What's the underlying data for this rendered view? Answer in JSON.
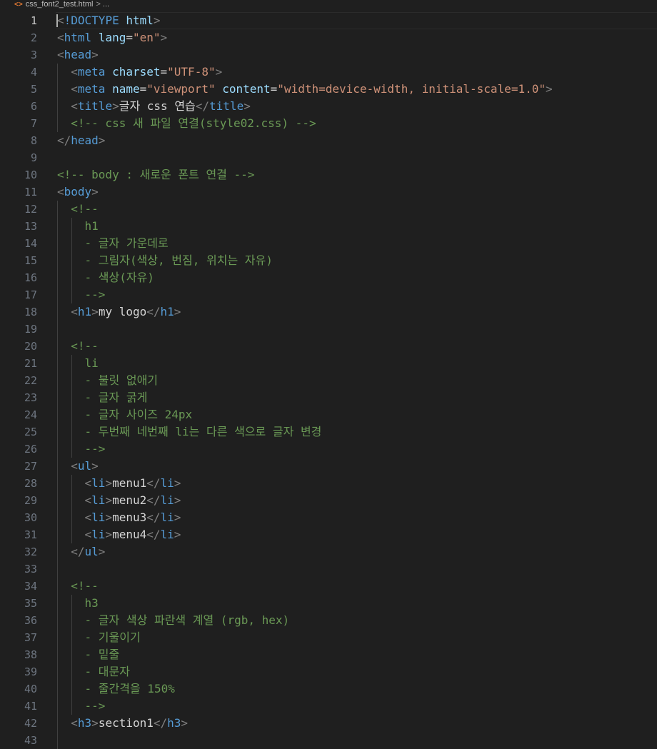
{
  "breadcrumb": {
    "icon": "html-file-icon",
    "icon_glyph": "<>",
    "file_name": "css_font2_test.html",
    "separator": ">",
    "rest": "..."
  },
  "editor": {
    "current_line": 1,
    "lines": [
      {
        "n": "1",
        "indent": 0,
        "tokens": [
          [
            "br",
            "<"
          ],
          [
            "doc",
            "!DOCTYPE "
          ],
          [
            "doctype-name",
            "html"
          ],
          [
            "br",
            ">"
          ]
        ]
      },
      {
        "n": "2",
        "indent": 0,
        "tokens": [
          [
            "br",
            "<"
          ],
          [
            "tag",
            "html "
          ],
          [
            "attr",
            "lang"
          ],
          [
            "text",
            "="
          ],
          [
            "str",
            "\"en\""
          ],
          [
            "br",
            ">"
          ]
        ]
      },
      {
        "n": "3",
        "indent": 0,
        "tokens": [
          [
            "br",
            "<"
          ],
          [
            "tag",
            "head"
          ],
          [
            "br",
            ">"
          ]
        ]
      },
      {
        "n": "4",
        "indent": 1,
        "tokens": [
          [
            "text",
            "  "
          ],
          [
            "br",
            "<"
          ],
          [
            "tag",
            "meta "
          ],
          [
            "attr",
            "charset"
          ],
          [
            "text",
            "="
          ],
          [
            "str",
            "\"UTF-8\""
          ],
          [
            "br",
            ">"
          ]
        ]
      },
      {
        "n": "5",
        "indent": 1,
        "tokens": [
          [
            "text",
            "  "
          ],
          [
            "br",
            "<"
          ],
          [
            "tag",
            "meta "
          ],
          [
            "attr",
            "name"
          ],
          [
            "text",
            "="
          ],
          [
            "str",
            "\"viewport\""
          ],
          [
            "text",
            " "
          ],
          [
            "attr",
            "content"
          ],
          [
            "text",
            "="
          ],
          [
            "str",
            "\"width=device-width, initial-scale=1.0\""
          ],
          [
            "br",
            ">"
          ]
        ]
      },
      {
        "n": "6",
        "indent": 1,
        "tokens": [
          [
            "text",
            "  "
          ],
          [
            "br",
            "<"
          ],
          [
            "tag",
            "title"
          ],
          [
            "br",
            ">"
          ],
          [
            "text",
            "글자 css 연습"
          ],
          [
            "br",
            "</"
          ],
          [
            "tag",
            "title"
          ],
          [
            "br",
            ">"
          ]
        ]
      },
      {
        "n": "7",
        "indent": 1,
        "tokens": [
          [
            "text",
            "  "
          ],
          [
            "com",
            "<!-- css 새 파일 연결(style02.css) -->"
          ]
        ]
      },
      {
        "n": "8",
        "indent": 0,
        "tokens": [
          [
            "br",
            "</"
          ],
          [
            "tag",
            "head"
          ],
          [
            "br",
            ">"
          ]
        ]
      },
      {
        "n": "9",
        "indent": 0,
        "tokens": []
      },
      {
        "n": "10",
        "indent": 0,
        "tokens": [
          [
            "com",
            "<!-- body : 새로운 폰트 연결 -->"
          ]
        ]
      },
      {
        "n": "11",
        "indent": 0,
        "tokens": [
          [
            "br",
            "<"
          ],
          [
            "tag",
            "body"
          ],
          [
            "br",
            ">"
          ]
        ]
      },
      {
        "n": "12",
        "indent": 1,
        "tokens": [
          [
            "text",
            "  "
          ],
          [
            "com",
            "<!--"
          ]
        ]
      },
      {
        "n": "13",
        "indent": 2,
        "tokens": [
          [
            "text",
            "    "
          ],
          [
            "com",
            "h1"
          ]
        ]
      },
      {
        "n": "14",
        "indent": 2,
        "tokens": [
          [
            "text",
            "    "
          ],
          [
            "com",
            "- 글자 가운데로"
          ]
        ]
      },
      {
        "n": "15",
        "indent": 2,
        "tokens": [
          [
            "text",
            "    "
          ],
          [
            "com",
            "- 그림자(색상, 번짐, 위치는 자유)"
          ]
        ]
      },
      {
        "n": "16",
        "indent": 2,
        "tokens": [
          [
            "text",
            "    "
          ],
          [
            "com",
            "- 색상(자유)"
          ]
        ]
      },
      {
        "n": "17",
        "indent": 2,
        "tokens": [
          [
            "text",
            "    "
          ],
          [
            "com",
            "-->"
          ]
        ]
      },
      {
        "n": "18",
        "indent": 1,
        "tokens": [
          [
            "text",
            "  "
          ],
          [
            "br",
            "<"
          ],
          [
            "tag",
            "h1"
          ],
          [
            "br",
            ">"
          ],
          [
            "text",
            "my logo"
          ],
          [
            "br",
            "</"
          ],
          [
            "tag",
            "h1"
          ],
          [
            "br",
            ">"
          ]
        ]
      },
      {
        "n": "19",
        "indent": 1,
        "tokens": []
      },
      {
        "n": "20",
        "indent": 1,
        "tokens": [
          [
            "text",
            "  "
          ],
          [
            "com",
            "<!--"
          ]
        ]
      },
      {
        "n": "21",
        "indent": 2,
        "tokens": [
          [
            "text",
            "    "
          ],
          [
            "com",
            "li"
          ]
        ]
      },
      {
        "n": "22",
        "indent": 2,
        "tokens": [
          [
            "text",
            "    "
          ],
          [
            "com",
            "- 불릿 없애기"
          ]
        ]
      },
      {
        "n": "23",
        "indent": 2,
        "tokens": [
          [
            "text",
            "    "
          ],
          [
            "com",
            "- 글자 굵게"
          ]
        ]
      },
      {
        "n": "24",
        "indent": 2,
        "tokens": [
          [
            "text",
            "    "
          ],
          [
            "com",
            "- 글자 사이즈 24px"
          ]
        ]
      },
      {
        "n": "25",
        "indent": 2,
        "tokens": [
          [
            "text",
            "    "
          ],
          [
            "com",
            "- 두번째 네번째 li는 다른 색으로 글자 변경"
          ]
        ]
      },
      {
        "n": "26",
        "indent": 2,
        "tokens": [
          [
            "text",
            "    "
          ],
          [
            "com",
            "-->"
          ]
        ]
      },
      {
        "n": "27",
        "indent": 1,
        "tokens": [
          [
            "text",
            "  "
          ],
          [
            "br",
            "<"
          ],
          [
            "tag",
            "ul"
          ],
          [
            "br",
            ">"
          ]
        ]
      },
      {
        "n": "28",
        "indent": 2,
        "tokens": [
          [
            "text",
            "    "
          ],
          [
            "br",
            "<"
          ],
          [
            "tag",
            "li"
          ],
          [
            "br",
            ">"
          ],
          [
            "text",
            "menu1"
          ],
          [
            "br",
            "</"
          ],
          [
            "tag",
            "li"
          ],
          [
            "br",
            ">"
          ]
        ]
      },
      {
        "n": "29",
        "indent": 2,
        "tokens": [
          [
            "text",
            "    "
          ],
          [
            "br",
            "<"
          ],
          [
            "tag",
            "li"
          ],
          [
            "br",
            ">"
          ],
          [
            "text",
            "menu2"
          ],
          [
            "br",
            "</"
          ],
          [
            "tag",
            "li"
          ],
          [
            "br",
            ">"
          ]
        ]
      },
      {
        "n": "30",
        "indent": 2,
        "tokens": [
          [
            "text",
            "    "
          ],
          [
            "br",
            "<"
          ],
          [
            "tag",
            "li"
          ],
          [
            "br",
            ">"
          ],
          [
            "text",
            "menu3"
          ],
          [
            "br",
            "</"
          ],
          [
            "tag",
            "li"
          ],
          [
            "br",
            ">"
          ]
        ]
      },
      {
        "n": "31",
        "indent": 2,
        "tokens": [
          [
            "text",
            "    "
          ],
          [
            "br",
            "<"
          ],
          [
            "tag",
            "li"
          ],
          [
            "br",
            ">"
          ],
          [
            "text",
            "menu4"
          ],
          [
            "br",
            "</"
          ],
          [
            "tag",
            "li"
          ],
          [
            "br",
            ">"
          ]
        ]
      },
      {
        "n": "32",
        "indent": 1,
        "tokens": [
          [
            "text",
            "  "
          ],
          [
            "br",
            "</"
          ],
          [
            "tag",
            "ul"
          ],
          [
            "br",
            ">"
          ]
        ]
      },
      {
        "n": "33",
        "indent": 1,
        "tokens": []
      },
      {
        "n": "34",
        "indent": 1,
        "tokens": [
          [
            "text",
            "  "
          ],
          [
            "com",
            "<!--"
          ]
        ]
      },
      {
        "n": "35",
        "indent": 2,
        "tokens": [
          [
            "text",
            "    "
          ],
          [
            "com",
            "h3"
          ]
        ]
      },
      {
        "n": "36",
        "indent": 2,
        "tokens": [
          [
            "text",
            "    "
          ],
          [
            "com",
            "- 글자 색상 파란색 계열 (rgb, hex)"
          ]
        ]
      },
      {
        "n": "37",
        "indent": 2,
        "tokens": [
          [
            "text",
            "    "
          ],
          [
            "com",
            "- 기울이기"
          ]
        ]
      },
      {
        "n": "38",
        "indent": 2,
        "tokens": [
          [
            "text",
            "    "
          ],
          [
            "com",
            "- 밑줄"
          ]
        ]
      },
      {
        "n": "39",
        "indent": 2,
        "tokens": [
          [
            "text",
            "    "
          ],
          [
            "com",
            "- 대문자"
          ]
        ]
      },
      {
        "n": "40",
        "indent": 2,
        "tokens": [
          [
            "text",
            "    "
          ],
          [
            "com",
            "- 줄간격을 150%"
          ]
        ]
      },
      {
        "n": "41",
        "indent": 2,
        "tokens": [
          [
            "text",
            "    "
          ],
          [
            "com",
            "-->"
          ]
        ]
      },
      {
        "n": "42",
        "indent": 1,
        "tokens": [
          [
            "text",
            "  "
          ],
          [
            "br",
            "<"
          ],
          [
            "tag",
            "h3"
          ],
          [
            "br",
            ">"
          ],
          [
            "text",
            "section1"
          ],
          [
            "br",
            "</"
          ],
          [
            "tag",
            "h3"
          ],
          [
            "br",
            ">"
          ]
        ]
      },
      {
        "n": "43",
        "indent": 1,
        "tokens": []
      }
    ]
  },
  "colors": {
    "background": "#1f1f1f",
    "tag": "#569cd6",
    "bracket": "#808080",
    "attribute": "#9cdcfe",
    "string": "#ce9178",
    "comment": "#6a9955",
    "text": "#d4d4d4"
  }
}
